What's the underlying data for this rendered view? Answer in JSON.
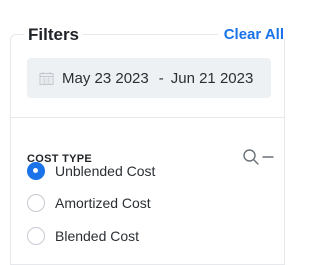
{
  "filters": {
    "title": "Filters",
    "clear_all_label": "Clear All",
    "date_range": {
      "icon": "calendar-icon",
      "start": "May 23 2023",
      "separator": "-",
      "end": "Jun 21 2023"
    }
  },
  "cost_type": {
    "title": "COST TYPE",
    "search_icon": "search-icon",
    "collapse_icon": "minus-icon",
    "options": [
      {
        "label": "Unblended Cost",
        "selected": true
      },
      {
        "label": "Amortized Cost",
        "selected": false
      },
      {
        "label": "Blended Cost",
        "selected": false
      }
    ]
  },
  "colors": {
    "accent": "#1a73e8",
    "date_box_bg": "#eef1f4",
    "border": "#e6e8eb",
    "text": "#1f2328"
  }
}
